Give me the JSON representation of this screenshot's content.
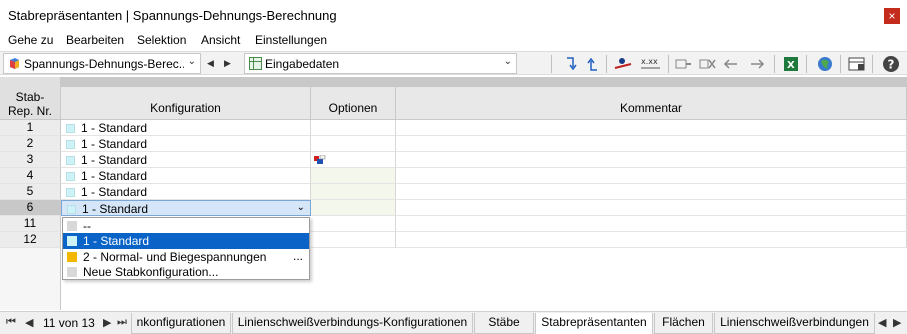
{
  "window": {
    "title": "Stabrepräsentanten | Spannungs-Dehnungs-Berechnung",
    "close_label": "×"
  },
  "menu": [
    "Gehe zu",
    "Bearbeiten",
    "Selektion",
    "Ansicht",
    "Einstellungen"
  ],
  "toolbar": {
    "module_combo": "Spannungs-Dehnungs-Berec...",
    "table_combo": "Eingabedaten",
    "prev_label": "◀",
    "next_label": "▶",
    "chevron": "⌄",
    "icons": [
      "swap-down-icon",
      "swap-up-icon",
      "member-eye-icon",
      "xxx-icon",
      "insert-row-icon",
      "delete-row-icon",
      "move-left-icon",
      "move-right-icon",
      "excel-export-icon",
      "globe-icon",
      "table-settings-icon",
      "help-icon"
    ]
  },
  "grid": {
    "headers": {
      "nr": "Stab-\nRep. Nr.",
      "config": "Konfiguration",
      "options": "Optionen",
      "comment": "Kommentar"
    },
    "rows": [
      {
        "nr": "1",
        "config": "1 - Standard"
      },
      {
        "nr": "2",
        "config": "1 - Standard"
      },
      {
        "nr": "3",
        "config": "1 - Standard"
      },
      {
        "nr": "4",
        "config": "1 - Standard"
      },
      {
        "nr": "5",
        "config": "1 - Standard"
      },
      {
        "nr": "6",
        "config": "1 - Standard"
      },
      {
        "nr": "11",
        "config": ""
      },
      {
        "nr": "12",
        "config": ""
      }
    ]
  },
  "dropdown": {
    "items": [
      {
        "label": "--",
        "color": "#d8d8d8"
      },
      {
        "label": "1 - Standard",
        "color": "#cdf2f8"
      },
      {
        "label": "2 - Normal- und Biegespannungen",
        "color": "#f2b800",
        "extra": "..."
      },
      {
        "label": "Neue Stabkonfiguration...",
        "color": "#d8d8d8"
      }
    ]
  },
  "statusbar": {
    "first": "⏮",
    "prev": "◀",
    "page": "11 von 13",
    "next": "▶",
    "last": "⏭",
    "tabs": [
      "nkonfigurationen",
      "Linienschweißverbindungs-Konfigurationen",
      "Stäbe",
      "Stabrepräsentanten",
      "Flächen",
      "Linienschweißverbindungen"
    ],
    "active_tab": "Stabrepräsentanten",
    "scroll_left": "◀",
    "scroll_right": "▶"
  },
  "colors": {
    "accent": "#0a64c8",
    "selection": "#d4e6f8",
    "standard_swatch": "#cdf2f8",
    "close": "#c42b1c"
  }
}
